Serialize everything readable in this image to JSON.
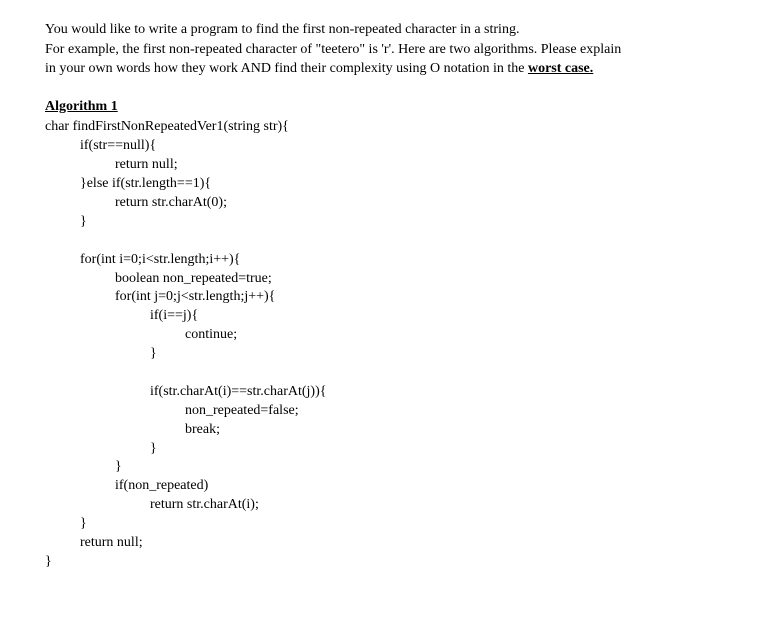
{
  "intro": {
    "line1": "You would like to write a program to find the first non-repeated character in a string.",
    "line2_part1": "For example, the first non-repeated character of \"teetero\" is 'r'. Here are two algorithms. Please explain",
    "line3_part1": "in your own words how they work AND find their complexity using O notation in the ",
    "line3_emphasis": "worst case."
  },
  "algorithm": {
    "heading": "Algorithm 1",
    "code": "char findFirstNonRepeatedVer1(string str){\n          if(str==null){\n                    return null;\n          }else if(str.length==1){\n                    return str.charAt(0);\n          }\n\n          for(int i=0;i<str.length;i++){\n                    boolean non_repeated=true;\n                    for(int j=0;j<str.length;j++){\n                              if(i==j){\n                                        continue;\n                              }\n\n                              if(str.charAt(i)==str.charAt(j)){\n                                        non_repeated=false;\n                                        break;\n                              }\n                    }\n                    if(non_repeated)\n                              return str.charAt(i);\n          }\n          return null;\n}"
  }
}
